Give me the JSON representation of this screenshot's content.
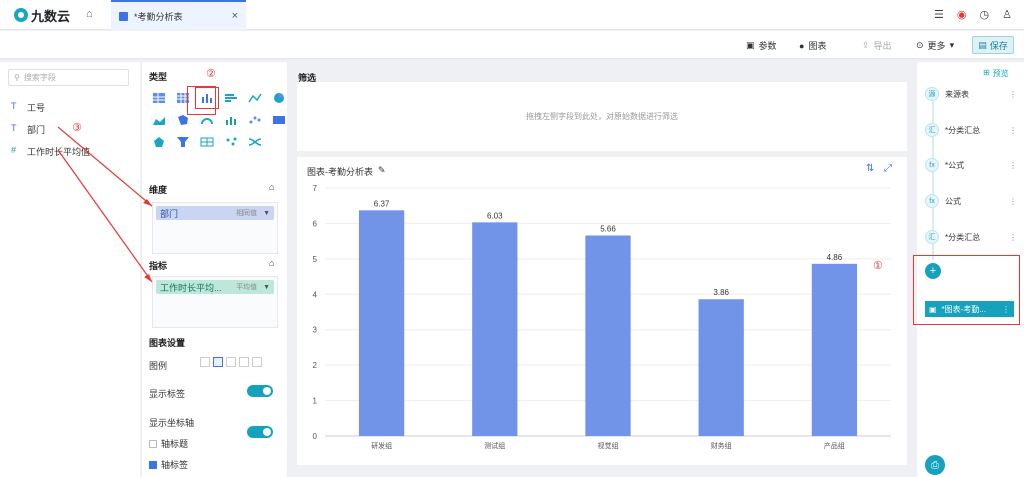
{
  "app": {
    "logo": "九数云"
  },
  "tab": {
    "title": "*考勤分析表",
    "close": "×"
  },
  "toolbar": {
    "params": "参数",
    "chart": "图表",
    "export": "导出",
    "more": "更多",
    "save": "保存"
  },
  "fields": {
    "search_placeholder": "搜索字段",
    "items": [
      {
        "type": "T",
        "name": "工号"
      },
      {
        "type": "T",
        "name": "部门"
      },
      {
        "type": "#",
        "name": "工作时长平均值"
      }
    ]
  },
  "type_panel": {
    "title": "类型",
    "dimension": {
      "title": "维度",
      "pill": "部门",
      "pill_sub": "相同值"
    },
    "metric": {
      "title": "指标",
      "pill": "工作时长平均...",
      "pill_sub": "平均值"
    },
    "settings": {
      "title": "图表设置",
      "legend": "图例",
      "show_label": "显示标签",
      "show_axis": "显示坐标轴",
      "axis_title": "轴标题",
      "axis_label": "轴标签"
    }
  },
  "filter": {
    "title": "筛选",
    "hint": "拖拽左侧字段到此处，对原始数据进行筛选"
  },
  "chart": {
    "title": "图表-考勤分析表"
  },
  "chart_data": {
    "type": "bar",
    "categories": [
      "研发组",
      "测试组",
      "视觉组",
      "财务组",
      "产品组"
    ],
    "values": [
      6.37,
      6.03,
      5.66,
      3.86,
      4.86
    ],
    "ylim": [
      0,
      7
    ],
    "yticks": [
      "0",
      "1",
      "2",
      "3",
      "4",
      "5",
      "6",
      "7"
    ],
    "bar_color": "#7294e8"
  },
  "pipeline": {
    "preview": "预览",
    "nodes": [
      {
        "icon": "源",
        "label": "来源表"
      },
      {
        "icon": "汇",
        "label": "*分类汇总"
      },
      {
        "icon": "fx",
        "label": "*公式"
      },
      {
        "icon": "fx",
        "label": "公式"
      },
      {
        "icon": "汇",
        "label": "*分类汇总"
      }
    ],
    "add": "+",
    "active": "*图表-考勤..."
  },
  "annotations": [
    "①",
    "②",
    "③"
  ]
}
